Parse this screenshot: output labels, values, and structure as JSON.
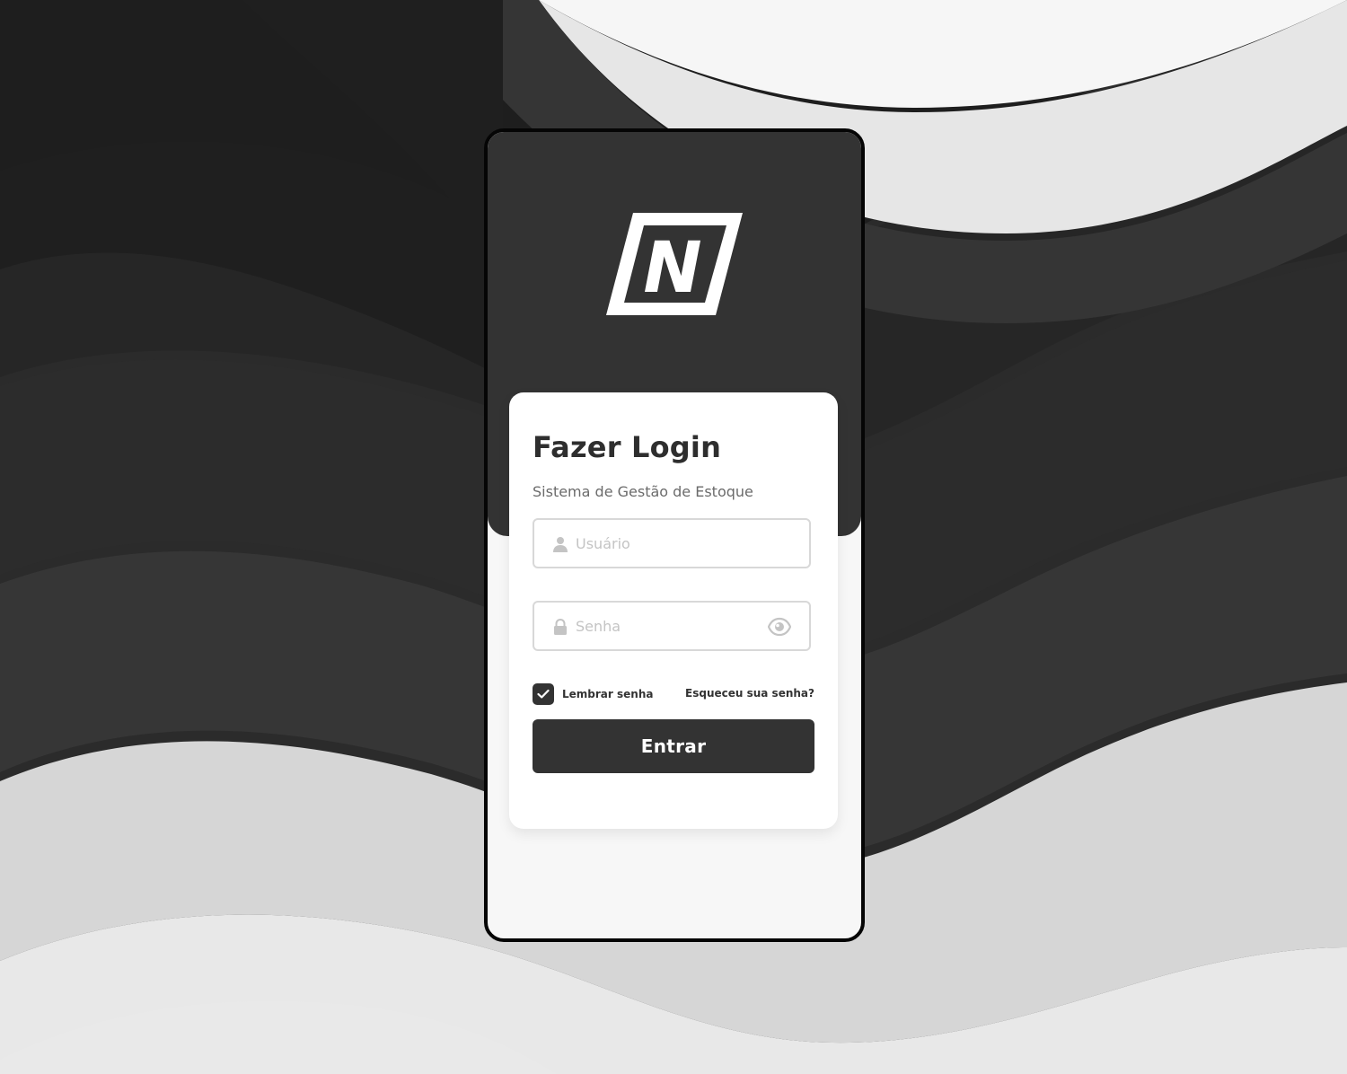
{
  "login": {
    "title": "Fazer Login",
    "subtitle": "Sistema de Gestão de Estoque",
    "username_placeholder": "Usuário",
    "password_placeholder": "Senha",
    "remember_label": "Lembrar senha",
    "remember_checked": true,
    "forgot_label": "Esqueceu sua senha?",
    "submit_label": "Entrar"
  },
  "brand": {
    "logo_letter": "N"
  },
  "icons": {
    "username": "user-icon",
    "password": "lock-icon",
    "toggle_password": "eye-icon",
    "checkbox": "check-icon"
  },
  "colors": {
    "header": "#333333",
    "card": "#ffffff",
    "button": "#333333",
    "placeholder": "#c4c4c4",
    "background_dark": "#2a2a2a",
    "background_light": "#e8e8e8"
  }
}
